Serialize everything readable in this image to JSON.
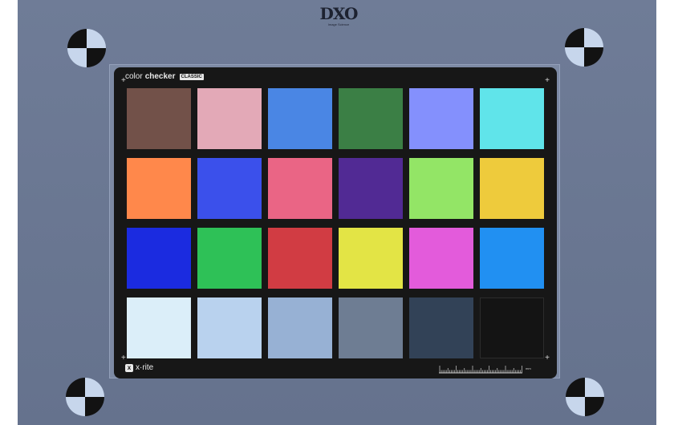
{
  "logo": {
    "main": "DXO",
    "sub": "Image Science"
  },
  "chart": {
    "brand_light": "color",
    "brand_bold": "checker",
    "brand_tag": "CLASSIC",
    "maker": "x·rite",
    "ruler_unit": "mm",
    "patches": [
      {
        "name": "dark-skin",
        "color": "#725149"
      },
      {
        "name": "light-skin",
        "color": "#e3a9b7"
      },
      {
        "name": "blue-sky",
        "color": "#4a86e4"
      },
      {
        "name": "foliage",
        "color": "#3b7f45"
      },
      {
        "name": "blue-flower",
        "color": "#8490fd"
      },
      {
        "name": "bluish-green",
        "color": "#60e4ea"
      },
      {
        "name": "orange",
        "color": "#ff884b"
      },
      {
        "name": "purplish-blue",
        "color": "#3b50eb"
      },
      {
        "name": "moderate-red",
        "color": "#ea6585"
      },
      {
        "name": "purple",
        "color": "#512a94"
      },
      {
        "name": "yellow-green",
        "color": "#93e566"
      },
      {
        "name": "orange-yellow",
        "color": "#eecb3c"
      },
      {
        "name": "blue",
        "color": "#1b2be0"
      },
      {
        "name": "green",
        "color": "#2ec157"
      },
      {
        "name": "red",
        "color": "#d13c43"
      },
      {
        "name": "yellow",
        "color": "#e3e445"
      },
      {
        "name": "magenta",
        "color": "#e35bdb"
      },
      {
        "name": "cyan",
        "color": "#2190f2"
      },
      {
        "name": "white",
        "color": "#dbeef9"
      },
      {
        "name": "neutral-8",
        "color": "#b9d2ee"
      },
      {
        "name": "neutral-6-5",
        "color": "#97b1d4"
      },
      {
        "name": "neutral-5",
        "color": "#6e7d93"
      },
      {
        "name": "neutral-3-5",
        "color": "#324257"
      },
      {
        "name": "black",
        "color": "#141414"
      }
    ]
  }
}
